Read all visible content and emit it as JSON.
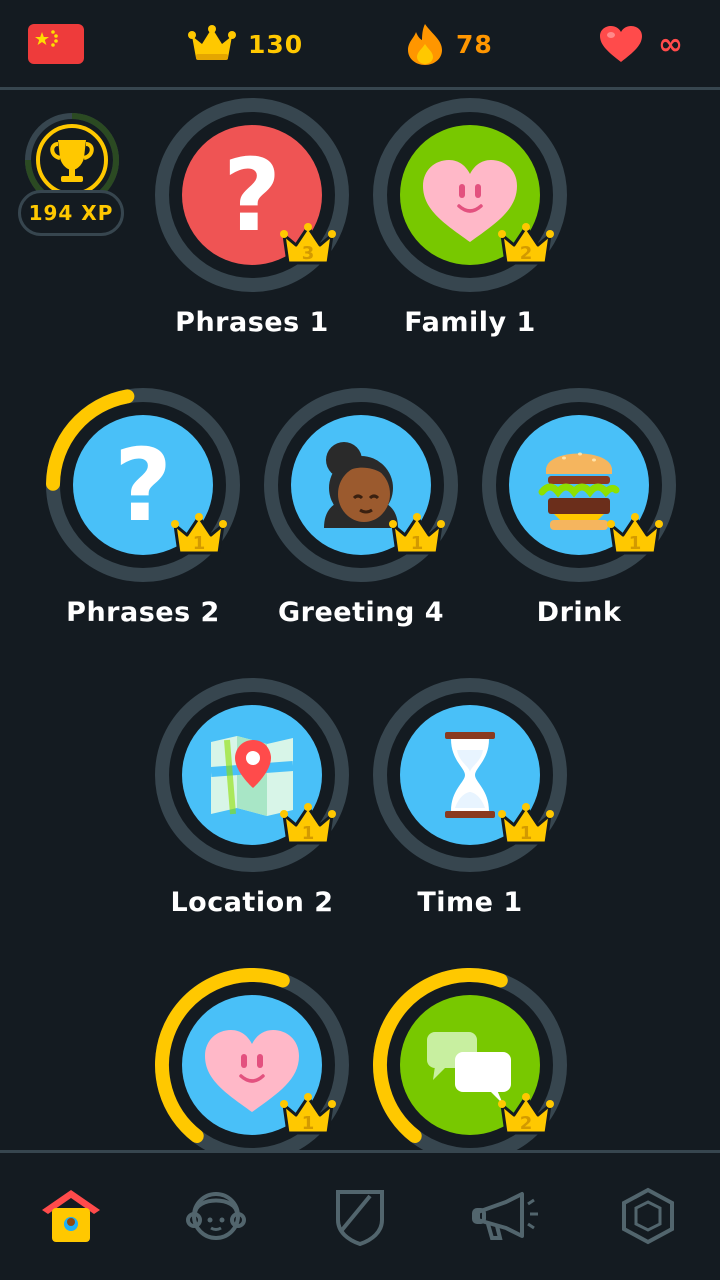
{
  "header": {
    "crowns": "130",
    "streak": "78",
    "hearts": "∞"
  },
  "trophy": {
    "xp": "194 XP"
  },
  "colors": {
    "background": "#141B21",
    "ring": "#37464F",
    "gold": "#FFC800",
    "red": "#EF5454",
    "green": "#78C800",
    "blue": "#49C0F8",
    "orange": "#FF9600"
  },
  "skills": [
    {
      "label": "Phrases 1",
      "level": "3",
      "icon": "question-icon",
      "color": "red",
      "progress": 0
    },
    {
      "label": "Family 1",
      "level": "2",
      "icon": "heart-face-icon",
      "color": "green",
      "progress": 0
    },
    {
      "label": "Phrases 2",
      "level": "1",
      "icon": "question-icon",
      "color": "blue",
      "progress": 0.22
    },
    {
      "label": "Greeting 4",
      "level": "1",
      "icon": "woman-face-icon",
      "color": "blue",
      "progress": 0
    },
    {
      "label": "Drink",
      "level": "1",
      "icon": "burger-icon",
      "color": "blue",
      "progress": 0
    },
    {
      "label": "Location 2",
      "level": "1",
      "icon": "map-pin-icon",
      "color": "blue",
      "progress": 0
    },
    {
      "label": "Time 1",
      "level": "1",
      "icon": "hourglass-icon",
      "color": "blue",
      "progress": 0
    },
    {
      "label": "",
      "level": "1",
      "icon": "heart-face-icon",
      "color": "blue",
      "progress": 0.45
    },
    {
      "label": "",
      "level": "2",
      "icon": "chat-bubbles-icon",
      "color": "green",
      "progress": 0.45
    }
  ],
  "nav": [
    {
      "name": "learn",
      "icon": "home-icon",
      "active": true
    },
    {
      "name": "profile",
      "icon": "profile-icon",
      "active": false
    },
    {
      "name": "leaderboard",
      "icon": "shield-icon",
      "active": false
    },
    {
      "name": "news",
      "icon": "megaphone-icon",
      "active": false
    },
    {
      "name": "shop",
      "icon": "gem-icon",
      "active": false
    }
  ]
}
